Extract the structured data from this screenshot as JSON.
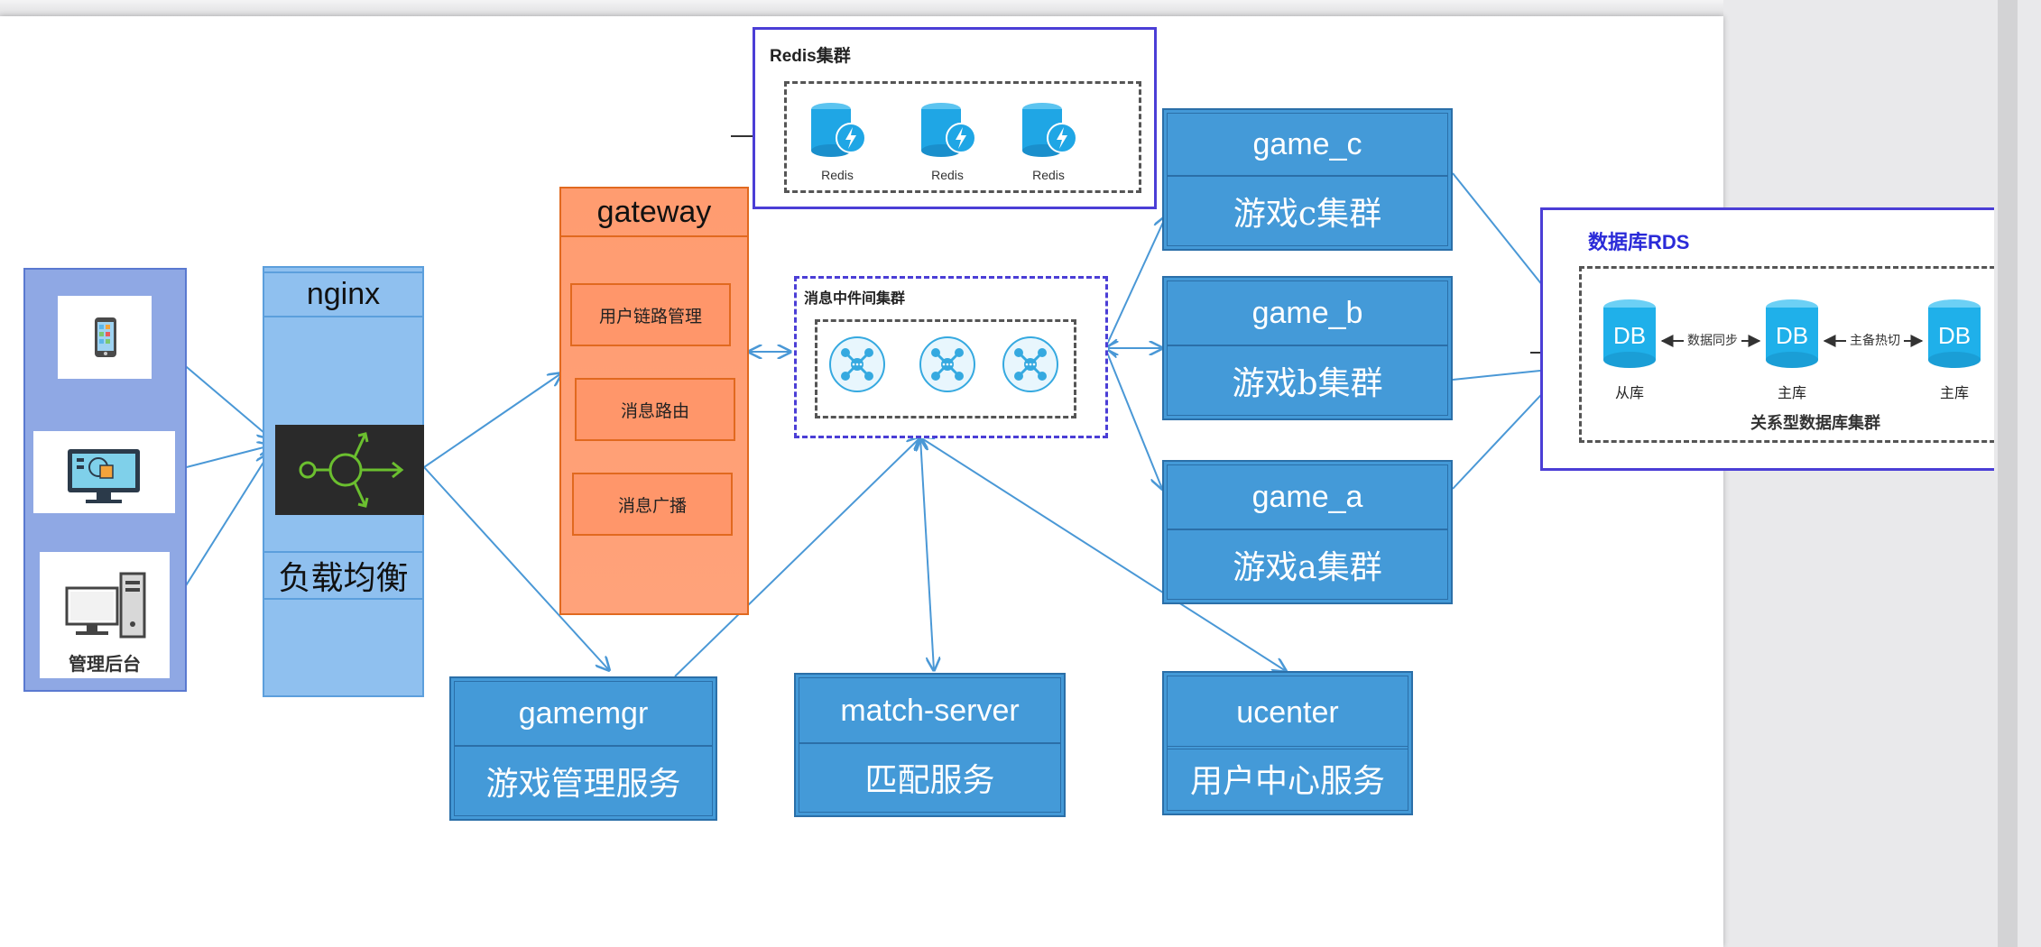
{
  "colors": {
    "service": "#449ad8",
    "gateway": "#ff966a",
    "arrow": "#4a98d6",
    "cluster_border": "#4b3ed6",
    "nginx": "#8fc0ef",
    "clients": "#8fa8e4",
    "redis": "#1fa6e5"
  },
  "clients": {
    "admin_label": "管理后台",
    "icons": [
      "mobile-phone-icon",
      "desktop-monitor-icon",
      "admin-pc-icon"
    ]
  },
  "nginx": {
    "title": "nginx",
    "subtitle": "负载均衡",
    "icon": "load-balancer-icon"
  },
  "gateway": {
    "title": "gateway",
    "items": [
      "用户链路管理",
      "消息路由",
      "消息广播"
    ]
  },
  "redis": {
    "title": "Redis集群",
    "node_label": "Redis"
  },
  "mq": {
    "title": "消息中件间集群"
  },
  "games": {
    "c": {
      "name": "game_c",
      "desc": "游戏c集群"
    },
    "b": {
      "name": "game_b",
      "desc": "游戏b集群"
    },
    "a": {
      "name": "game_a",
      "desc": "游戏a集群"
    }
  },
  "services": {
    "gamemgr": {
      "name": "gamemgr",
      "desc": "游戏管理服务"
    },
    "match": {
      "name": "match-server",
      "desc": "匹配服务"
    },
    "ucenter": {
      "name": "ucenter",
      "desc": "用户中心服务"
    }
  },
  "rds": {
    "title": "数据库RDS",
    "db_text": "DB",
    "nodes": [
      "从库",
      "主库",
      "主库"
    ],
    "link1": "数据同步",
    "link2": "主备热切",
    "footer": "关系型数据库集群"
  }
}
